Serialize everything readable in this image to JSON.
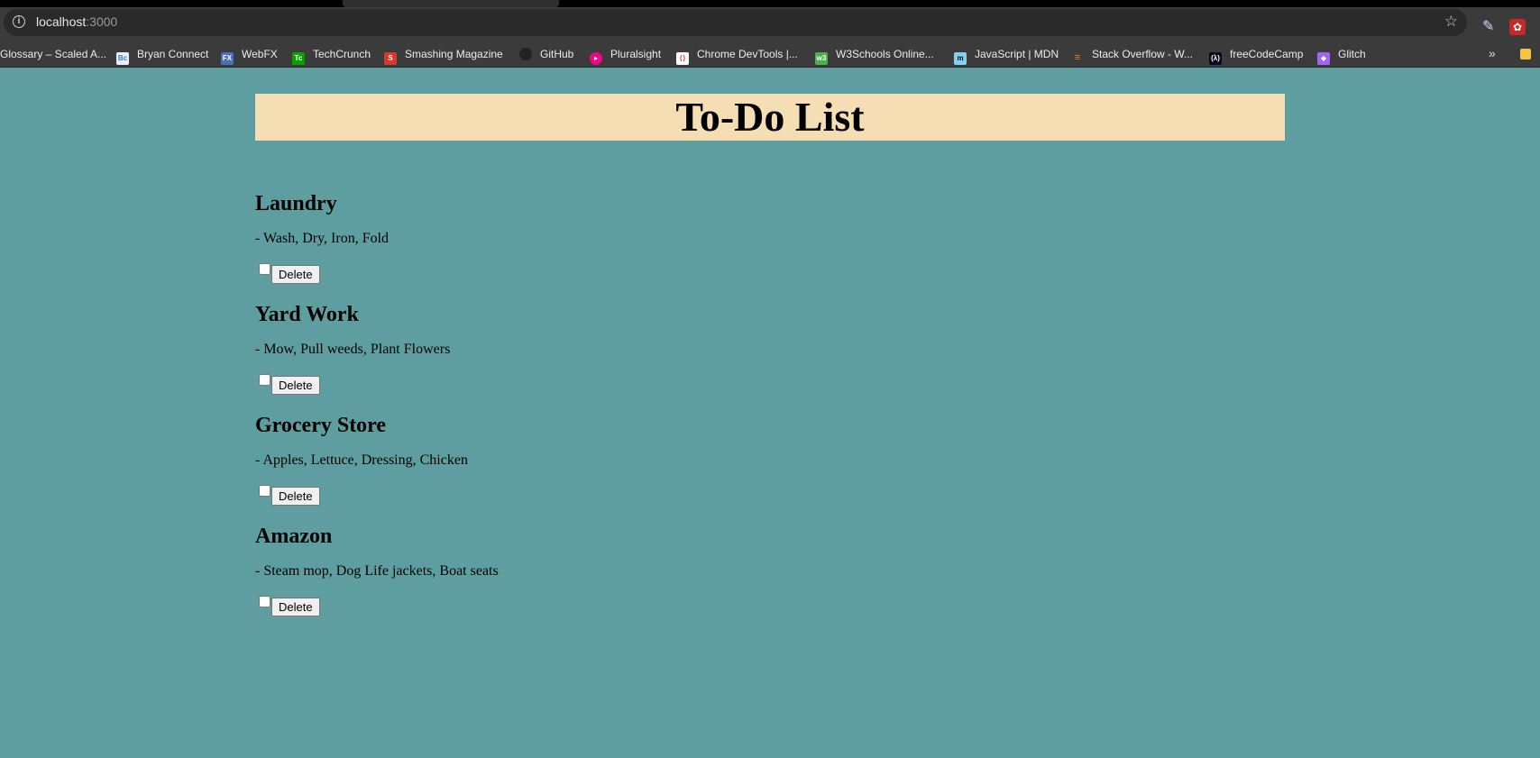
{
  "browser": {
    "url_host": "localhost",
    "url_port": ":3000",
    "bookmarks": [
      {
        "label": "Glossary – Scaled A...",
        "icon": "scaled-agile-icon",
        "color": "#3b3b3b"
      },
      {
        "label": "Bryan Connect",
        "icon": "bryan-connect-icon",
        "color": "#e8f0ff"
      },
      {
        "label": "WebFX",
        "icon": "webfx-icon",
        "color": "#4a6fb5"
      },
      {
        "label": "TechCrunch",
        "icon": "techcrunch-icon",
        "color": "#0a9e01"
      },
      {
        "label": "Smashing Magazine",
        "icon": "smashing-magazine-icon",
        "color": "#d33a2c"
      },
      {
        "label": "GitHub",
        "icon": "github-icon",
        "color": "#222222"
      },
      {
        "label": "Pluralsight",
        "icon": "pluralsight-icon",
        "color": "#e80a89"
      },
      {
        "label": "Chrome DevTools |...",
        "icon": "chrome-devtools-icon",
        "color": "#ffffff"
      },
      {
        "label": "W3Schools Online...",
        "icon": "w3schools-icon",
        "color": "#4caf50"
      },
      {
        "label": "JavaScript | MDN",
        "icon": "mdn-icon",
        "color": "#83d0f2"
      },
      {
        "label": "Stack Overflow - W...",
        "icon": "stack-overflow-icon",
        "color": "#f48024"
      },
      {
        "label": "freeCodeCamp",
        "icon": "freecodecamp-icon",
        "color": "#0a0a23"
      },
      {
        "label": "Glitch",
        "icon": "glitch-icon",
        "color": "#a463f2"
      }
    ]
  },
  "page": {
    "title": "To-Do List",
    "delete_label": "Delete",
    "todos": [
      {
        "title": "Laundry",
        "details": "- Wash, Dry, Iron, Fold"
      },
      {
        "title": "Yard Work",
        "details": "- Mow, Pull weeds, Plant Flowers"
      },
      {
        "title": "Grocery Store",
        "details": "- Apples, Lettuce, Dressing, Chicken"
      },
      {
        "title": "Amazon",
        "details": "- Steam mop, Dog Life jackets, Boat seats"
      }
    ]
  },
  "colors": {
    "page_background": "#5f9ea0",
    "header_background": "#f5deb3"
  }
}
